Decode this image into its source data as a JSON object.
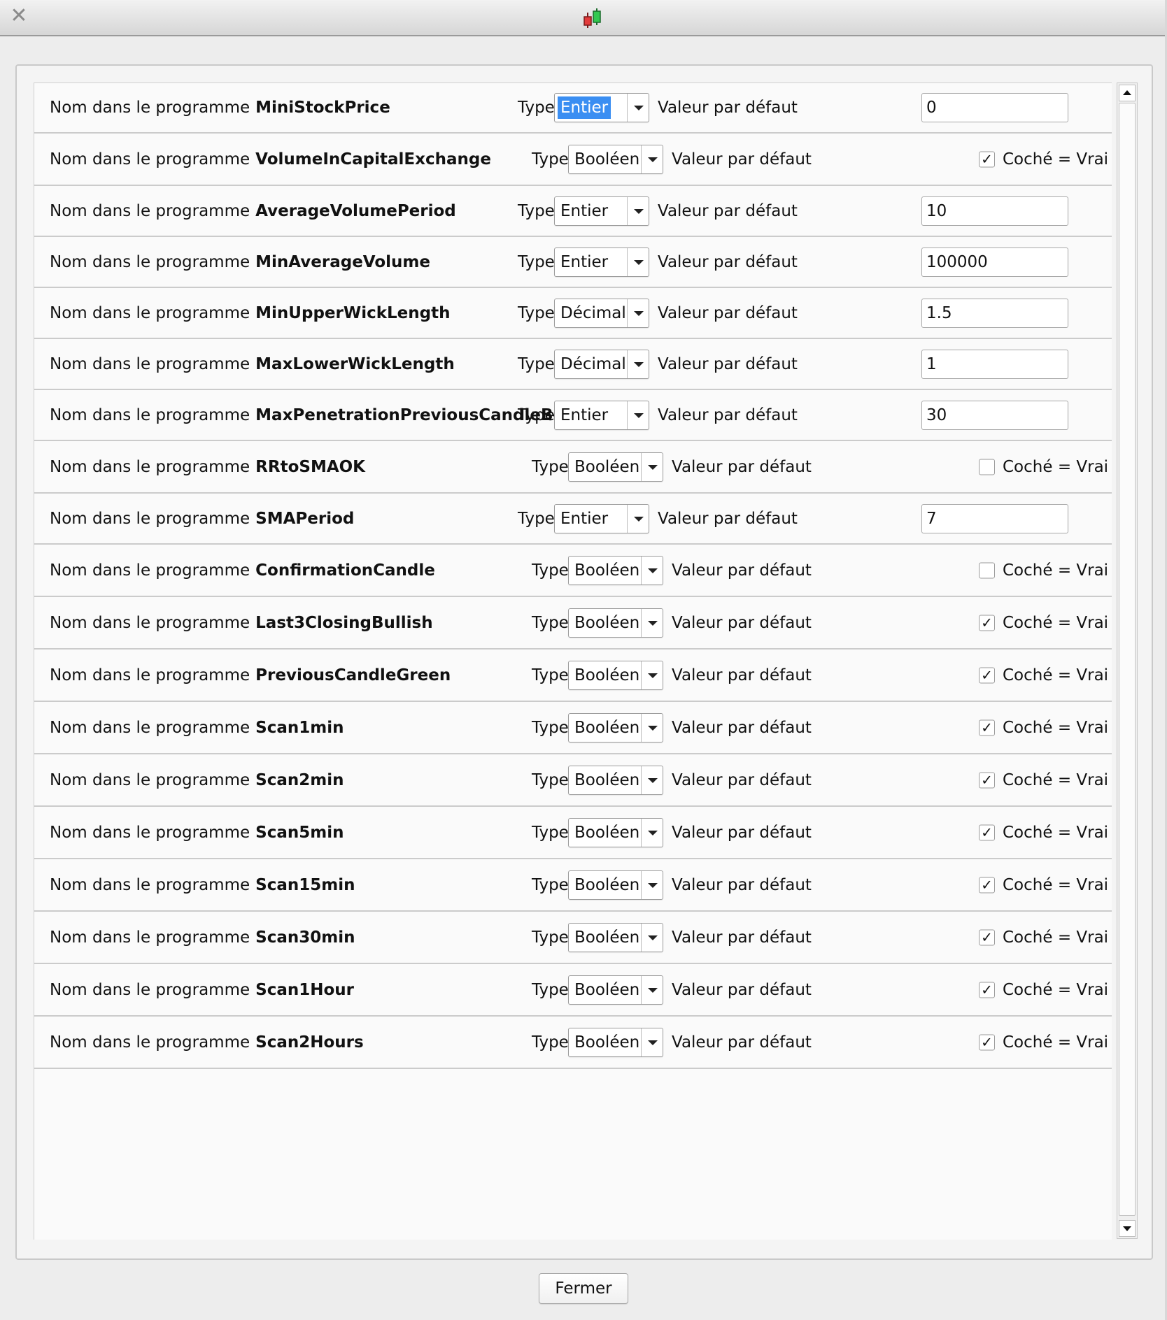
{
  "window": {
    "close_icon_glyph": "✕",
    "logo_colors": {
      "red": "#e23b3b",
      "green": "#32c850"
    }
  },
  "labels": {
    "name_prefix": "Nom dans le programme",
    "type": "Type",
    "default": "Valeur par défaut",
    "check_text": "Coché = Vrai",
    "check_glyph": "✓"
  },
  "params": [
    {
      "name": "MiniStockPrice",
      "type": "Entier",
      "default": "0",
      "selected": true
    },
    {
      "name": "VolumeInCapitalExchange",
      "type": "Booléen",
      "checked": true
    },
    {
      "name": "AverageVolumePeriod",
      "type": "Entier",
      "default": "10"
    },
    {
      "name": "MinAverageVolume",
      "type": "Entier",
      "default": "100000"
    },
    {
      "name": "MinUpperWickLength",
      "type": "Décimal",
      "default": "1.5"
    },
    {
      "name": "MaxLowerWickLength",
      "type": "Décimal",
      "default": "1"
    },
    {
      "name": "MaxPenetrationPreviousCandleBody",
      "type": "Entier",
      "default": "30"
    },
    {
      "name": "RRtoSMAOK",
      "type": "Booléen",
      "checked": false
    },
    {
      "name": "SMAPeriod",
      "type": "Entier",
      "default": "7"
    },
    {
      "name": "ConfirmationCandle",
      "type": "Booléen",
      "checked": false
    },
    {
      "name": "Last3ClosingBullish",
      "type": "Booléen",
      "checked": true
    },
    {
      "name": "PreviousCandleGreen",
      "type": "Booléen",
      "checked": true
    },
    {
      "name": "Scan1min",
      "type": "Booléen",
      "checked": true
    },
    {
      "name": "Scan2min",
      "type": "Booléen",
      "checked": true
    },
    {
      "name": "Scan5min",
      "type": "Booléen",
      "checked": true
    },
    {
      "name": "Scan15min",
      "type": "Booléen",
      "checked": true
    },
    {
      "name": "Scan30min",
      "type": "Booléen",
      "checked": true
    },
    {
      "name": "Scan1Hour",
      "type": "Booléen",
      "checked": true
    },
    {
      "name": "Scan2Hours",
      "type": "Booléen",
      "checked": true
    }
  ],
  "footer": {
    "close_label": "Fermer"
  },
  "colors": {
    "selection": "#3a8ef2"
  }
}
